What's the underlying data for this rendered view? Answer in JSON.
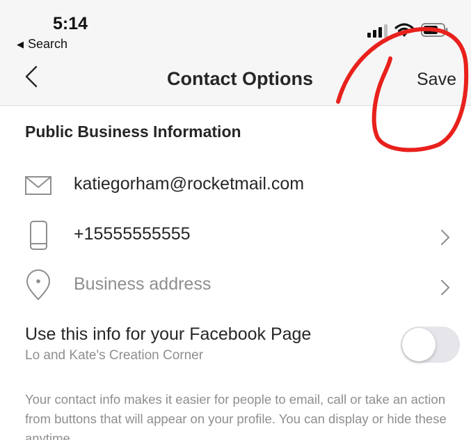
{
  "status_bar": {
    "time": "5:14",
    "back_app_label": "Search",
    "signal_icon": "cellular-signal-icon",
    "wifi_icon": "wifi-icon",
    "battery_icon": "battery-icon"
  },
  "header": {
    "back_icon": "chevron-left-icon",
    "title": "Contact Options",
    "save_label": "Save"
  },
  "section": {
    "title": "Public Business Information"
  },
  "fields": [
    {
      "icon": "mail-icon",
      "value": "katiegorham@rocketmail.com",
      "is_placeholder": false,
      "has_chevron": false
    },
    {
      "icon": "phone-icon",
      "value": "+15555555555",
      "is_placeholder": false,
      "has_chevron": true
    },
    {
      "icon": "location-pin-icon",
      "value": "Business address",
      "is_placeholder": true,
      "has_chevron": true
    }
  ],
  "facebook": {
    "title": "Use this info for your Facebook Page",
    "page_name": "Lo and Kate's Creation Corner",
    "toggle_on": false
  },
  "footer_text": "Your contact info makes it easier for people to email, call or take an action from buttons that will appear on your profile. You can display or hide these anytime.",
  "colors": {
    "text_primary": "#262626",
    "text_secondary": "#8e8e8e",
    "header_bg": "#f6f6f6",
    "annotation_red": "#e8211c"
  }
}
